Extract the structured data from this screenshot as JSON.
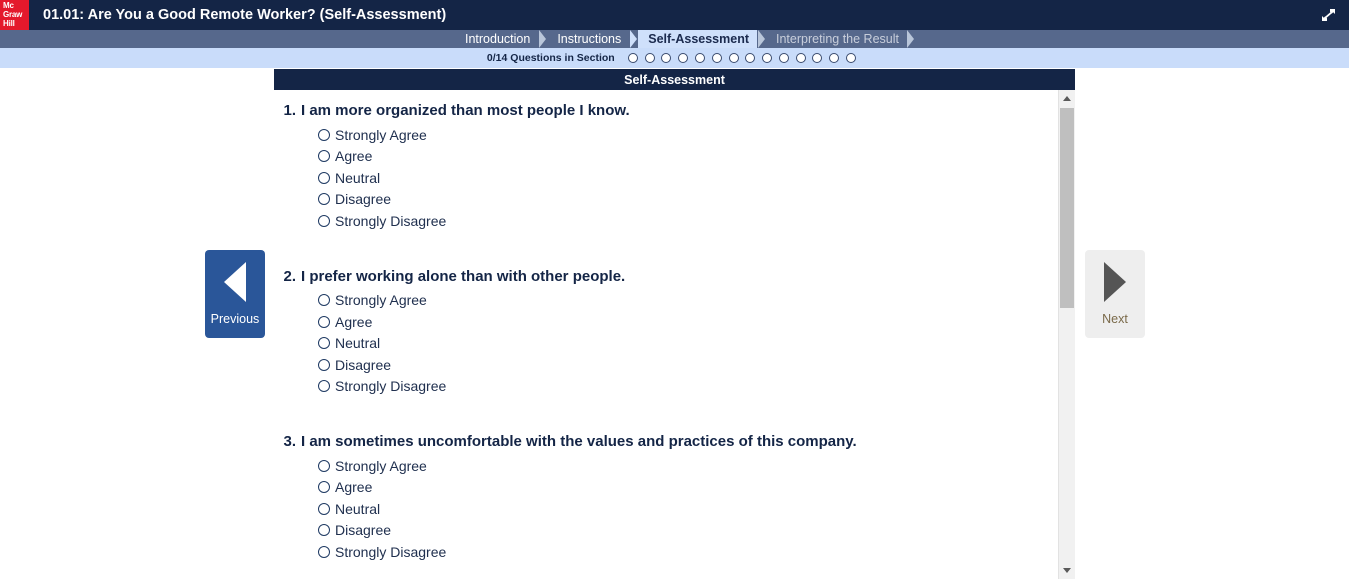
{
  "titlebar": {
    "logo_lines": [
      "Mc",
      "Graw",
      "Hill"
    ],
    "course_title": "01.01: Are You a Good Remote Worker? (Self-Assessment)",
    "expand_icon": "expand-diagonal-icon",
    "background_color": "#142546",
    "logo_color": "#e4192c"
  },
  "tabs": [
    {
      "label": "Introduction",
      "state": "completed"
    },
    {
      "label": "Instructions",
      "state": "completed"
    },
    {
      "label": "Self-Assessment",
      "state": "active"
    },
    {
      "label": "Interpreting the Result",
      "state": "upcoming"
    }
  ],
  "progress": {
    "label": "0/14 Questions in Section",
    "answered": 0,
    "total": 14,
    "dots": [
      "empty",
      "empty",
      "empty",
      "empty",
      "empty",
      "empty",
      "empty",
      "empty",
      "empty",
      "empty",
      "empty",
      "empty",
      "empty",
      "empty"
    ]
  },
  "section": {
    "header": "Self-Assessment"
  },
  "questions": [
    {
      "number": "1.",
      "text": "I am more organized than most people I know.",
      "options": [
        {
          "label": "Strongly Agree",
          "selected": false
        },
        {
          "label": "Agree",
          "selected": false
        },
        {
          "label": "Neutral",
          "selected": false
        },
        {
          "label": "Disagree",
          "selected": false
        },
        {
          "label": "Strongly Disagree",
          "selected": false
        }
      ]
    },
    {
      "number": "2.",
      "text": "I prefer working alone than with other people.",
      "options": [
        {
          "label": "Strongly Agree",
          "selected": false
        },
        {
          "label": "Agree",
          "selected": false
        },
        {
          "label": "Neutral",
          "selected": false
        },
        {
          "label": "Disagree",
          "selected": false
        },
        {
          "label": "Strongly Disagree",
          "selected": false
        }
      ]
    },
    {
      "number": "3.",
      "text": "I am sometimes uncomfortable with the values and practices of this company.",
      "options": [
        {
          "label": "Strongly Agree",
          "selected": false
        },
        {
          "label": "Agree",
          "selected": false
        },
        {
          "label": "Neutral",
          "selected": false
        },
        {
          "label": "Disagree",
          "selected": false
        },
        {
          "label": "Strongly Disagree",
          "selected": false
        }
      ]
    }
  ],
  "navigation": {
    "previous": {
      "label": "Previous",
      "icon": "triangle-left-icon",
      "enabled": true
    },
    "next": {
      "label": "Next",
      "icon": "triangle-right-icon",
      "enabled": false
    }
  },
  "scrollbar": {
    "up_icon": "triangle-up-icon",
    "down_icon": "triangle-down-icon",
    "thumb_position_percent": 0
  },
  "colors": {
    "navy": "#142546",
    "slate": "#56688c",
    "light_blue": "#c9dcfa",
    "active_tab": "#cfe0fb",
    "prev_button": "#2a5699",
    "next_button": "#eeeeee"
  }
}
